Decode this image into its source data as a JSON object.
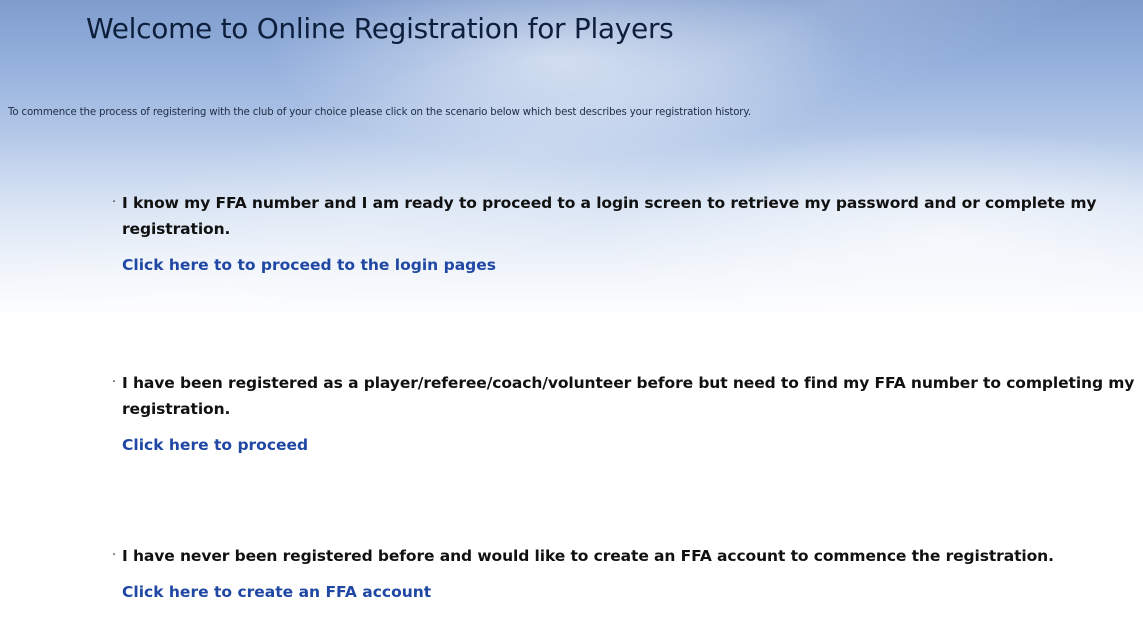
{
  "page": {
    "title": "Welcome to Online Registration for Players",
    "intro": "To commence the process of registering with the club of your choice please click on the scenario below which best describes your registration history."
  },
  "options": [
    {
      "text": "I know my FFA number and I am ready to proceed to a login screen to retrieve my password and or complete my registration.",
      "link": "Click here to to proceed to the login pages"
    },
    {
      "text": "I have been registered as a player/referee/coach/volunteer before but need to find my FFA number to completing my registration.",
      "link": "Click here to proceed"
    },
    {
      "text": "I have never been registered before and would like to create an FFA account to commence the registration.",
      "link": "Click here to create an FFA account"
    }
  ],
  "colors": {
    "title": "#0d1f3c",
    "link": "#1f47a3",
    "banner_top": "#7f9ccd"
  }
}
